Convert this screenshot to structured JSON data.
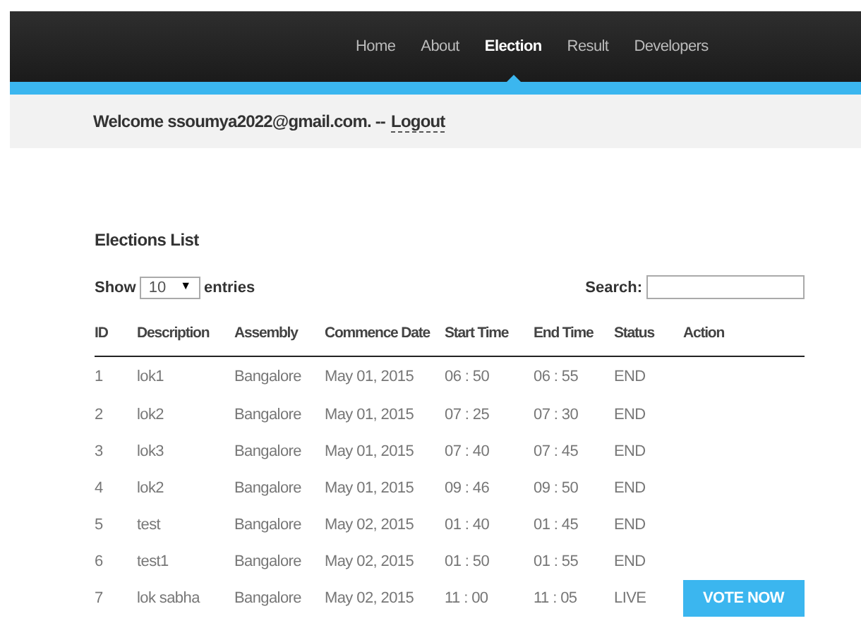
{
  "nav": [
    {
      "label": "Home",
      "selected": false
    },
    {
      "label": "About",
      "selected": false
    },
    {
      "label": "Election",
      "selected": true
    },
    {
      "label": "Result",
      "selected": false
    },
    {
      "label": "Developers",
      "selected": false
    }
  ],
  "welcome": {
    "text": "Welcome ssoumya2022@gmail.com. --",
    "link": "Logout"
  },
  "section_title": "Elections List",
  "length_control": {
    "prefix": "Show",
    "value": "10",
    "arrow": "▼",
    "suffix": "entries"
  },
  "search": {
    "label": "Search:"
  },
  "table": {
    "columns": [
      "ID",
      "Description",
      "Assembly",
      "Commence Date",
      "Start Time",
      "End Time",
      "Status",
      "Action"
    ],
    "rows": [
      {
        "cells": [
          "1",
          "lok1",
          "Bangalore",
          "May 01, 2015",
          "06 : 50",
          "06 : 55",
          "END"
        ]
      },
      {
        "cells": [
          "2",
          "lok2",
          "Bangalore",
          "May 01, 2015",
          "07 : 25",
          "07 : 30",
          "END"
        ]
      },
      {
        "cells": [
          "3",
          "lok3",
          "Bangalore",
          "May 01, 2015",
          "07 : 40",
          "07 : 45",
          "END"
        ]
      },
      {
        "cells": [
          "4",
          "lok2",
          "Bangalore",
          "May 01, 2015",
          "09 : 46",
          "09 : 50",
          "END"
        ]
      },
      {
        "cells": [
          "5",
          "test",
          "Bangalore",
          "May 02, 2015",
          "01 : 40",
          "01 : 45",
          "END"
        ]
      },
      {
        "cells": [
          "6",
          "test1",
          "Bangalore",
          "May 02, 2015",
          "01 : 50",
          "01 : 55",
          "END"
        ]
      },
      {
        "cells": [
          "7",
          "lok sabha",
          "Bangalore",
          "May 02, 2015",
          "11 : 00",
          "11 : 05",
          "LIVE"
        ],
        "action": "VOTE NOW"
      }
    ]
  }
}
